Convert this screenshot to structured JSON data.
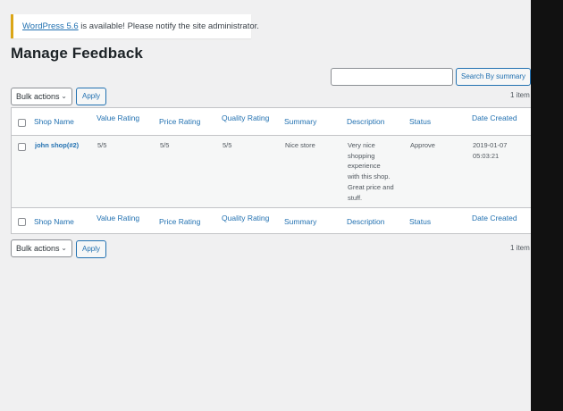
{
  "notice": {
    "link_text": "WordPress 5.6",
    "message": " is available! Please notify the site administrator."
  },
  "page": {
    "title": "Manage Feedback"
  },
  "search": {
    "placeholder": "",
    "button_label": "Search By summary"
  },
  "top_nav": {
    "bulk_label": "Bulk actions",
    "apply_label": "Apply",
    "items_count": "1 item"
  },
  "bottom_nav": {
    "bulk_label": "Bulk actions",
    "apply_label": "Apply",
    "items_count": "1 item"
  },
  "table": {
    "columns": [
      "Shop Name",
      "Value Rating",
      "Price Rating",
      "Quality Rating",
      "Summary",
      "Description",
      "Status",
      "Date Created"
    ],
    "rows": [
      {
        "shop_name": "john shop(#2)",
        "value_rating": "5/5",
        "price_rating": "5/5",
        "quality_rating": "5/5",
        "summary": "Nice store",
        "description_lines": [
          "Very nice",
          "shopping",
          "experience",
          "with this shop.",
          "Great price and",
          "stuff."
        ],
        "status": "Approve",
        "date_line1": "2019-01-07",
        "date_line2": "05:03:21"
      }
    ]
  },
  "colors": {
    "accent": "#2271b1",
    "notice_border": "#dba617",
    "background": "#f0f0f1"
  }
}
